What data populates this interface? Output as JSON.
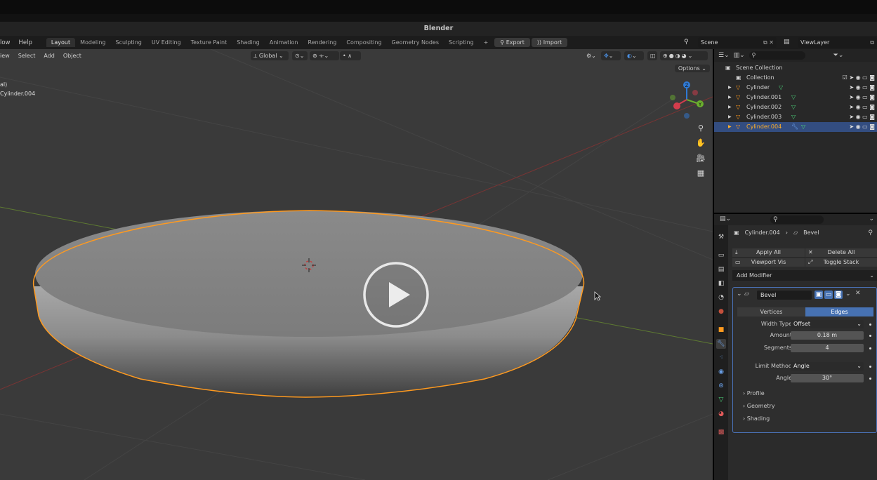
{
  "window": {
    "title": "Blender"
  },
  "menubar": {
    "items": [
      "low",
      "Help"
    ],
    "workspaces": [
      "Layout",
      "Modeling",
      "Sculpting",
      "UV Editing",
      "Texture Paint",
      "Shading",
      "Animation",
      "Rendering",
      "Compositing",
      "Geometry Nodes",
      "Scripting"
    ],
    "active_workspace": "Layout",
    "add_tab": "+",
    "export_label": "Export",
    "import_label": "Import",
    "scene": "Scene",
    "view_layer": "ViewLayer"
  },
  "viewport": {
    "menu": [
      "iew",
      "Select",
      "Add",
      "Object"
    ],
    "transform_orientation": "Global",
    "options_label": "Options",
    "info_line1": "al)",
    "info_line2": "Cylinder.004"
  },
  "outliner": {
    "scene_collection": "Scene Collection",
    "collection": "Collection",
    "objects": [
      {
        "name": "Cylinder",
        "selected": false,
        "has_modifier": false
      },
      {
        "name": "Cylinder.001",
        "selected": false,
        "has_modifier": false
      },
      {
        "name": "Cylinder.002",
        "selected": false,
        "has_modifier": false
      },
      {
        "name": "Cylinder.003",
        "selected": false,
        "has_modifier": false
      },
      {
        "name": "Cylinder.004",
        "selected": true,
        "has_modifier": true
      }
    ]
  },
  "properties": {
    "object_name": "Cylinder.004",
    "modifier_crumb": "Bevel",
    "apply_all": "Apply All",
    "delete_all": "Delete All",
    "viewport_vis": "Viewport Vis",
    "toggle_stack": "Toggle Stack",
    "add_modifier": "Add Modifier",
    "modifier": {
      "name": "Bevel",
      "affect_options": [
        "Vertices",
        "Edges"
      ],
      "affect_selected": "Edges",
      "width_type_label": "Width Type",
      "width_type": "Offset",
      "amount_label": "Amount",
      "amount": "0.18 m",
      "segments_label": "Segments",
      "segments": "4",
      "limit_method_label": "Limit Method",
      "limit_method": "Angle",
      "angle_label": "Angle",
      "angle": "30°",
      "subpanels": [
        "Profile",
        "Geometry",
        "Shading"
      ]
    }
  },
  "colors": {
    "selection_outline": "#ff9a1f",
    "active_row": "#334d80",
    "accent_blue": "#4772b3"
  }
}
